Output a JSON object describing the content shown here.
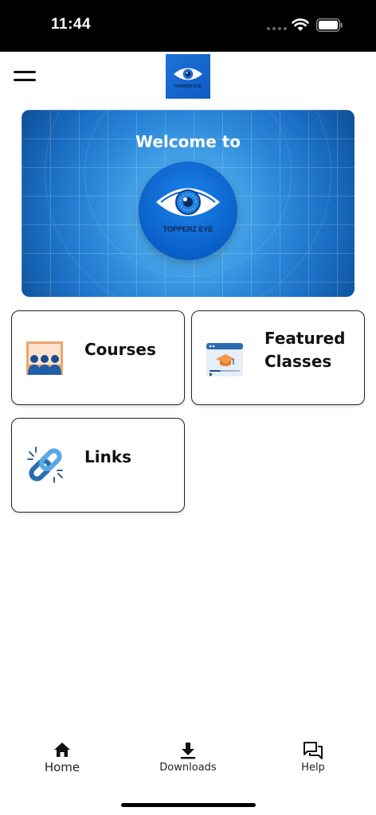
{
  "status_bar": {
    "time": "11:44"
  },
  "header": {
    "logo_caption": "TOPPERZ EYE"
  },
  "banner": {
    "title": "Welcome to",
    "caption": "TOPPERZ EYE",
    "colors": {
      "background": "#2c89da",
      "logo_circle": "#0a5fc9"
    }
  },
  "menu": {
    "items": [
      {
        "label": "Courses",
        "icon": "classroom-icon"
      },
      {
        "label_line1": "Featured",
        "label_line2": "Classes",
        "icon": "online-class-icon"
      },
      {
        "label": "Links",
        "icon": "link-icon"
      }
    ]
  },
  "bottom_nav": {
    "items": [
      {
        "label": "Home",
        "icon": "home-icon"
      },
      {
        "label": "Downloads",
        "icon": "download-icon"
      },
      {
        "label": "Help",
        "icon": "chat-icon"
      }
    ]
  }
}
